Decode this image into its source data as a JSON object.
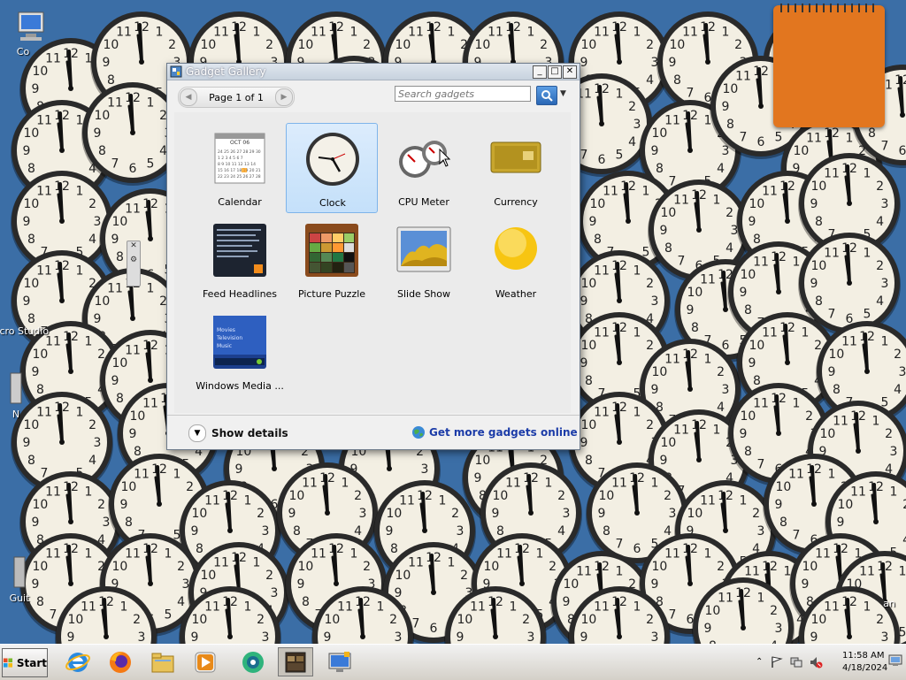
{
  "desktop": {
    "icons": [
      {
        "label": "Co",
        "icon": "computer-icon"
      },
      {
        "label": "Micro Studio",
        "icon": "app-icon"
      },
      {
        "label": "N",
        "icon": "app-icon"
      },
      {
        "label": "Guit",
        "icon": "app-icon"
      },
      {
        "label": "an",
        "icon": "app-icon"
      }
    ]
  },
  "window": {
    "title": "Gadget Gallery",
    "minimize": "_",
    "maximize": "□",
    "close": "✕"
  },
  "toolbar": {
    "page_text": "Page 1 of 1",
    "prev": "◀",
    "next": "▶",
    "search_placeholder": "Search gadgets"
  },
  "gadgets": [
    {
      "label": "Calendar",
      "icon": "calendar-icon",
      "selected": false,
      "month": "OCT 06"
    },
    {
      "label": "Clock",
      "icon": "clock-icon",
      "selected": true
    },
    {
      "label": "CPU Meter",
      "icon": "cpu-meter-icon",
      "selected": false
    },
    {
      "label": "Currency",
      "icon": "currency-icon",
      "selected": false
    },
    {
      "label": "Feed Headlines",
      "icon": "feed-icon",
      "selected": false
    },
    {
      "label": "Picture Puzzle",
      "icon": "puzzle-icon",
      "selected": false
    },
    {
      "label": "Slide Show",
      "icon": "slideshow-icon",
      "selected": false
    },
    {
      "label": "Weather",
      "icon": "weather-icon",
      "selected": false
    },
    {
      "label": "Windows Media ...",
      "icon": "media-center-icon",
      "selected": false,
      "menu": [
        "Movies",
        "Television",
        "Music"
      ]
    }
  ],
  "footer": {
    "show_details": "Show details",
    "get_more": "Get more gadgets online"
  },
  "taskbar": {
    "start_label": "Start",
    "apps": [
      "ie-icon",
      "firefox-icon",
      "folder-icon",
      "media-player-icon",
      "app-icon",
      "gadget-app-icon",
      "remote-desktop-icon"
    ],
    "time": "11:58 AM",
    "date": "4/18/2024"
  },
  "colors": {
    "desktop": "#3b6ea6",
    "link": "#1c3ca8",
    "selection": "#c4e0fa",
    "notepad": "#e2761f"
  }
}
